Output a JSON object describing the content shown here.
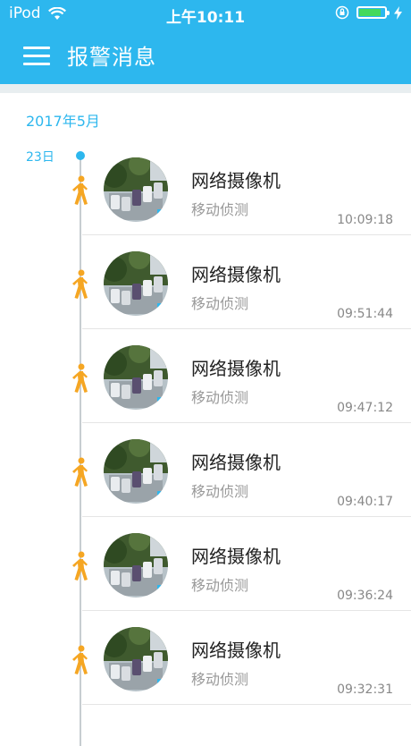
{
  "status_bar": {
    "device": "iPod",
    "time": "上午10:11"
  },
  "header": {
    "title": "报警消息"
  },
  "timeline": {
    "month": "2017年5月",
    "day": "23日"
  },
  "alarms": [
    {
      "name": "网络摄像机",
      "event": "移动侦测",
      "time": "10:09:18"
    },
    {
      "name": "网络摄像机",
      "event": "移动侦测",
      "time": "09:51:44"
    },
    {
      "name": "网络摄像机",
      "event": "移动侦测",
      "time": "09:47:12"
    },
    {
      "name": "网络摄像机",
      "event": "移动侦测",
      "time": "09:40:17"
    },
    {
      "name": "网络摄像机",
      "event": "移动侦测",
      "time": "09:36:24"
    },
    {
      "name": "网络摄像机",
      "event": "移动侦测",
      "time": "09:32:31"
    }
  ],
  "colors": {
    "accent": "#2db7ee",
    "walker": "#f5a623",
    "battery": "#44d95c"
  },
  "icons": [
    "menu-icon",
    "wifi-icon",
    "orientation-lock-icon",
    "battery-icon",
    "charging-icon",
    "walking-person-icon"
  ],
  "battery_level": 0.85
}
